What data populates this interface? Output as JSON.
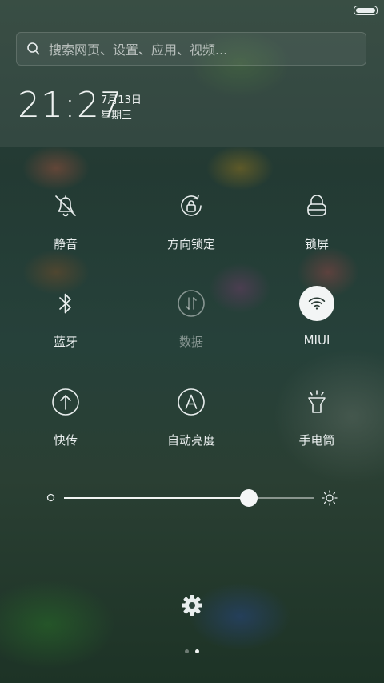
{
  "search": {
    "placeholder": "搜索网页、设置、应用、视频..."
  },
  "header": {
    "time": "21:27",
    "date": "7月13日",
    "weekday": "星期三"
  },
  "toggles": [
    {
      "id": "mute",
      "label": "静音",
      "icon": "bell-off-icon",
      "state": "off"
    },
    {
      "id": "rotation-lock",
      "label": "方向锁定",
      "icon": "rotation-lock-icon",
      "state": "off"
    },
    {
      "id": "lock-screen",
      "label": "锁屏",
      "icon": "lock-icon",
      "state": "off"
    },
    {
      "id": "bluetooth",
      "label": "蓝牙",
      "icon": "bluetooth-icon",
      "state": "off"
    },
    {
      "id": "data",
      "label": "数据",
      "icon": "mobile-data-icon",
      "state": "disabled"
    },
    {
      "id": "wifi",
      "label": "MIUI",
      "icon": "wifi-icon",
      "state": "on"
    },
    {
      "id": "quick-send",
      "label": "快传",
      "icon": "upload-icon",
      "state": "off"
    },
    {
      "id": "auto-brightness",
      "label": "自动亮度",
      "icon": "auto-brightness-icon",
      "state": "off"
    },
    {
      "id": "flashlight",
      "label": "手电筒",
      "icon": "flashlight-icon",
      "state": "off"
    }
  ],
  "brightness": {
    "level": 0.74
  },
  "pager": {
    "pages": 2,
    "current": 2
  },
  "colors": {
    "accent": "#f3f5f5",
    "text": "#e9eeee"
  }
}
